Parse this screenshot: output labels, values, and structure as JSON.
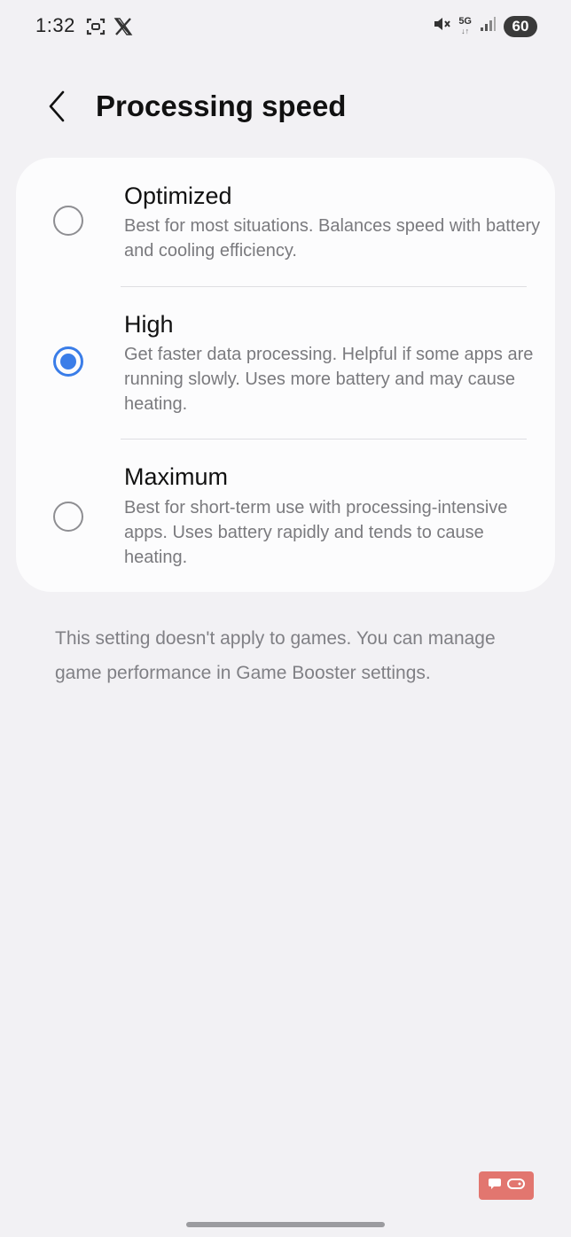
{
  "status_bar": {
    "time": "1:32",
    "left_icons": [
      "screen-record-icon",
      "x-app-icon"
    ],
    "right_icons": [
      "mute-icon",
      "5g-icon",
      "signal-icon"
    ],
    "network": "5G",
    "battery": "60"
  },
  "header": {
    "back_icon": "chevron-left-icon",
    "title": "Processing speed"
  },
  "options": [
    {
      "title": "Optimized",
      "description": "Best for most situations. Balances speed with battery and cooling efficiency.",
      "selected": false
    },
    {
      "title": "High",
      "description": "Get faster data processing. Helpful if some apps are running slowly. Uses more battery and may cause heating.",
      "selected": true
    },
    {
      "title": "Maximum",
      "description": "Best for short-term use with processing-intensive apps. Uses battery rapidly and tends to cause heating.",
      "selected": false
    }
  ],
  "footnote": "This setting doesn't apply to games. You can manage game performance in Game Booster settings.",
  "colors": {
    "accent": "#3a7de8",
    "background": "#f2f1f4",
    "card": "#fcfcfd",
    "secondary_text": "#7a7a7e"
  }
}
